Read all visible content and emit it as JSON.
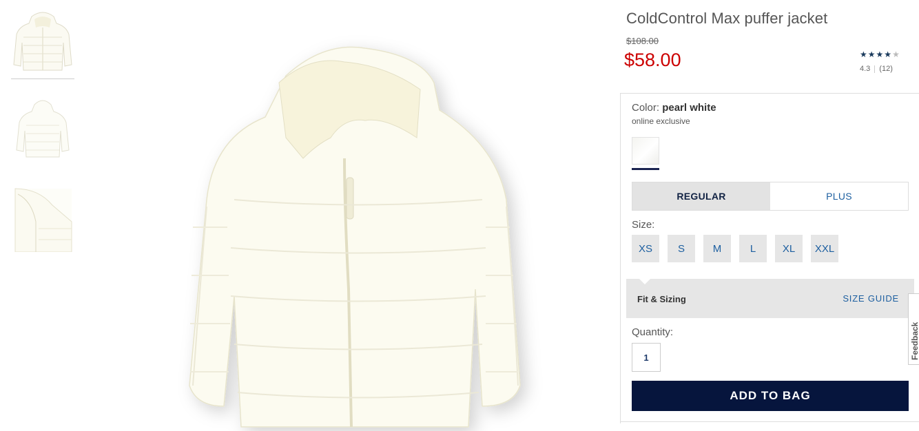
{
  "product": {
    "title": "ColdControl Max puffer jacket",
    "original_price": "$108.00",
    "sale_price": "$58.00",
    "rating": {
      "stars_filled": 4.3,
      "stars_max": 5,
      "value": "4.3",
      "count": "(12)"
    }
  },
  "color": {
    "label": "Color:",
    "name": "pearl white",
    "note": "online exclusive",
    "swatch_color": "#f7f7f3"
  },
  "fit_tabs": [
    {
      "label": "REGULAR",
      "selected": true
    },
    {
      "label": "PLUS",
      "selected": false
    }
  ],
  "size": {
    "label": "Size:",
    "options": [
      "XS",
      "S",
      "M",
      "L",
      "XL",
      "XXL"
    ]
  },
  "fit_sizing": {
    "title": "Fit & Sizing",
    "link": "SIZE GUIDE"
  },
  "quantity": {
    "label": "Quantity:",
    "value": "1"
  },
  "cta": {
    "add_to_bag": "ADD TO BAG"
  },
  "feedback": {
    "label": "Feedback"
  },
  "colors": {
    "price_red": "#cc0000",
    "cta_navy": "#06153d",
    "link_blue": "#1d5fa0"
  }
}
